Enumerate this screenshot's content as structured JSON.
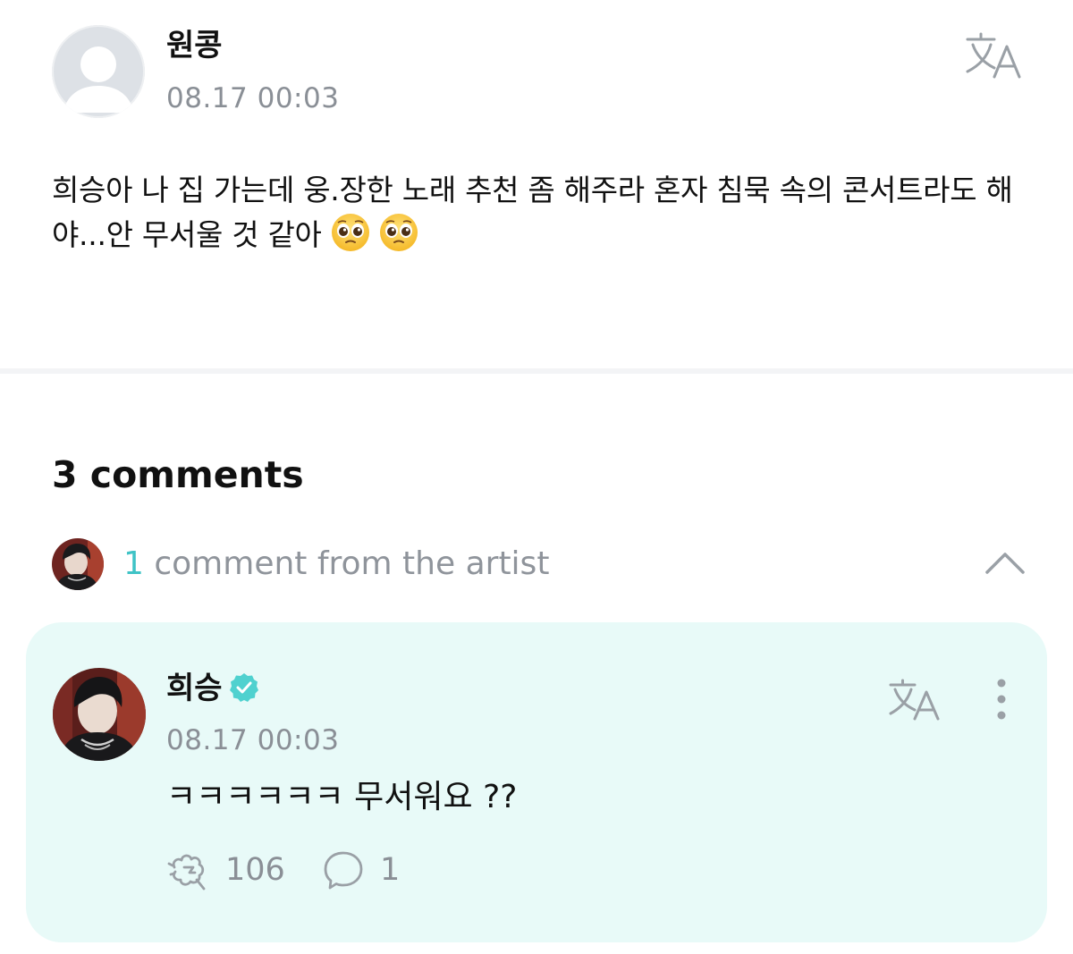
{
  "post": {
    "author": "원콩",
    "time": "08.17 00:03",
    "body": "희승아 나 집 가는데 웅.장한 노래 추천 좀 해주라 혼자 침묵 속의 콘서트라도 해야...안 무서울 것 같아",
    "emojis": [
      "pleading-face-emoji",
      "pleading-face-emoji"
    ],
    "translate_icon": "translate-icon"
  },
  "comments": {
    "count_label": "3 comments",
    "artist_summary": {
      "count": "1",
      "label": "comment from the artist",
      "toggle_icon": "chevron-up-icon"
    },
    "artist_comment": {
      "author": "희승",
      "verified_icon": "verified-badge-icon",
      "time": "08.17 00:03",
      "text": "ㅋㅋㅋㅋㅋㅋ 무서워요 ??",
      "likes": "106",
      "replies": "1",
      "like_icon": "cheer-icon",
      "reply_icon": "comment-bubble-icon",
      "more_icon": "more-vertical-icon"
    }
  },
  "colors": {
    "accent": "#3fc3c6",
    "artist_card_bg": "#e8faf8",
    "muted_text": "#8a8f96"
  }
}
